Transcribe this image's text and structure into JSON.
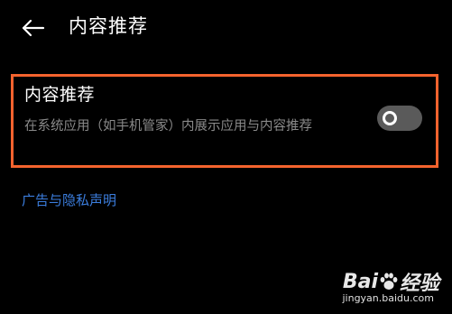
{
  "header": {
    "back_icon": "arrow-left-icon",
    "title": "内容推荐"
  },
  "setting": {
    "title": "内容推荐",
    "description": "在系统应用（如手机管家）内展示应用与内容推荐",
    "toggle_state": "off",
    "highlight_color": "#f4632e"
  },
  "links": {
    "privacy": "广告与隐私声明",
    "color": "#3b7ddd"
  },
  "watermark": {
    "logo_left": "Bai",
    "logo_right": "经验",
    "paw_icon": "baidu-paw-icon",
    "url": "jingyan.baidu.com"
  }
}
